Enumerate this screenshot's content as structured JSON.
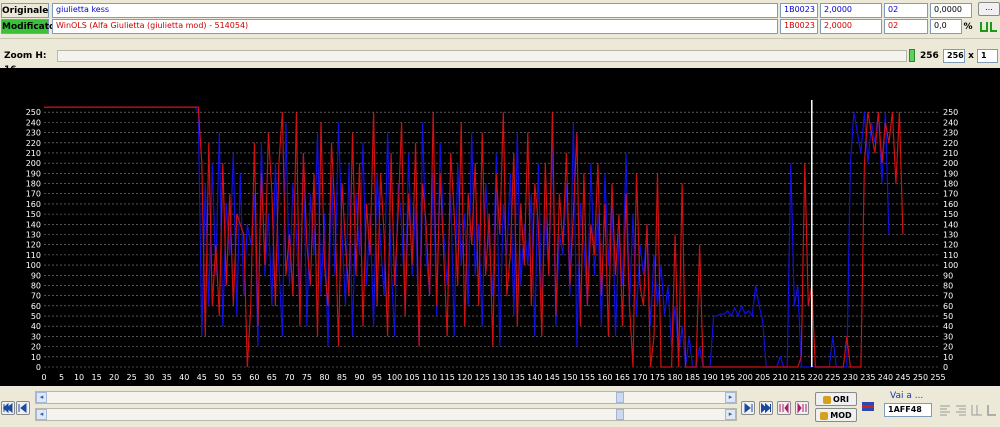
{
  "header": {
    "original_label": "Originale",
    "modified_label": "Modificato",
    "original": {
      "name": "giulietta kess",
      "address": "1B0023",
      "factor": "2,0000",
      "width": "02",
      "offset": "0,0000"
    },
    "modified": {
      "name": "WinOLS (Alfa Giulietta (giulietta mod) - 514054)",
      "address": "1B0023",
      "factor": "2,0000",
      "width": "02",
      "offset": "0,0"
    },
    "percent_symbol": "%",
    "ellipsis_button": "...",
    "close_glyph": "×"
  },
  "zoombar": {
    "label": "Zoom H: 16",
    "width_value": "256",
    "width_field": "256",
    "times_symbol": "x",
    "multiplier": "1"
  },
  "chart_data": {
    "type": "line",
    "ylim": [
      0,
      260
    ],
    "xlim": [
      0,
      255
    ],
    "y_ticks": [
      "0",
      "10",
      "20",
      "30",
      "40",
      "50",
      "60",
      "70",
      "80",
      "90",
      "100",
      "110",
      "120",
      "130",
      "140",
      "150",
      "160",
      "170",
      "180",
      "190",
      "200",
      "210",
      "220",
      "230",
      "240",
      "250"
    ],
    "x_ticks": [
      "0",
      "5",
      "10",
      "15",
      "20",
      "25",
      "30",
      "35",
      "40",
      "45",
      "50",
      "55",
      "60",
      "65",
      "70",
      "75",
      "80",
      "85",
      "90",
      "95",
      "100",
      "105",
      "110",
      "115",
      "120",
      "125",
      "130",
      "135",
      "140",
      "145",
      "150",
      "155",
      "160",
      "165",
      "170",
      "175",
      "180",
      "185",
      "190",
      "195",
      "200",
      "205",
      "210",
      "215",
      "220",
      "225",
      "230",
      "235",
      "240",
      "245",
      "250",
      "255"
    ],
    "cursor_x": 219,
    "grid": "horizontal-dashed",
    "colors": {
      "original": "#1010e0",
      "modified": "#d01010",
      "background": "#000000",
      "grid": "#8a8a8a",
      "cursor": "#ffffff"
    },
    "series": [
      {
        "color": "#1010e0",
        "values": [
          255,
          255,
          255,
          255,
          255,
          255,
          255,
          255,
          255,
          255,
          255,
          255,
          255,
          255,
          255,
          255,
          255,
          255,
          255,
          255,
          255,
          255,
          255,
          255,
          255,
          255,
          255,
          255,
          255,
          255,
          255,
          255,
          255,
          255,
          255,
          255,
          255,
          255,
          255,
          255,
          255,
          255,
          255,
          255,
          250,
          30,
          180,
          60,
          200,
          90,
          230,
          40,
          160,
          110,
          210,
          50,
          190,
          70,
          140,
          120,
          170,
          20,
          220,
          90,
          150,
          60,
          200,
          100,
          30,
          240,
          80,
          180,
          130,
          60,
          210,
          40,
          170,
          110,
          230,
          70,
          150,
          20,
          190,
          90,
          240,
          130,
          60,
          200,
          30,
          170,
          110,
          220,
          80,
          150,
          40,
          190,
          120,
          70,
          230,
          100,
          30,
          180,
          140,
          60,
          210,
          90,
          160,
          20,
          240,
          110,
          70,
          190,
          50,
          220,
          130,
          80,
          170,
          30,
          200,
          100,
          150,
          60,
          230,
          90,
          140,
          40,
          180,
          120,
          70,
          210,
          20,
          160,
          110,
          190,
          50,
          230,
          80,
          140,
          100,
          170,
          30,
          200,
          60,
          150,
          90,
          220,
          40,
          130,
          110,
          180,
          70,
          240,
          20,
          160,
          120,
          60,
          200,
          90,
          150,
          40,
          190,
          100,
          170,
          30,
          130,
          80,
          210,
          60,
          150,
          50,
          120,
          90,
          140,
          40,
          110,
          60,
          100,
          50,
          80,
          20,
          60,
          10,
          40,
          0,
          30,
          0,
          0,
          20,
          0,
          0,
          0,
          50,
          50,
          52,
          52,
          55,
          50,
          58,
          50,
          60,
          52,
          55,
          50,
          80,
          60,
          45,
          0,
          0,
          0,
          0,
          10,
          0,
          0,
          200,
          60,
          80,
          0,
          0,
          0,
          0,
          0,
          0,
          0,
          0,
          0,
          30,
          0,
          0,
          0,
          0,
          200,
          250,
          230,
          210,
          250,
          200,
          240,
          220,
          250,
          180,
          250,
          130
        ]
      },
      {
        "color": "#d01010",
        "values": [
          255,
          255,
          255,
          255,
          255,
          255,
          255,
          255,
          255,
          255,
          255,
          255,
          255,
          255,
          255,
          255,
          255,
          255,
          255,
          255,
          255,
          255,
          255,
          255,
          255,
          255,
          255,
          255,
          255,
          255,
          255,
          255,
          255,
          255,
          255,
          255,
          255,
          255,
          255,
          255,
          255,
          255,
          255,
          255,
          255,
          200,
          30,
          220,
          60,
          120,
          50,
          200,
          80,
          170,
          60,
          150,
          140,
          130,
          0,
          60,
          220,
          40,
          190,
          100,
          230,
          170,
          60,
          200,
          250,
          90,
          130,
          70,
          250,
          40,
          210,
          120,
          80,
          190,
          30,
          240,
          100,
          60,
          220,
          150,
          20,
          180,
          120,
          70,
          230,
          90,
          200,
          40,
          160,
          110,
          250,
          60,
          190,
          130,
          30,
          210,
          80,
          150,
          240,
          50,
          170,
          100,
          220,
          20,
          180,
          140,
          70,
          250,
          60,
          190,
          110,
          30,
          210,
          150,
          80,
          240,
          40,
          170,
          120,
          200,
          60,
          230,
          90,
          150,
          20,
          190,
          130,
          250,
          70,
          110,
          210,
          40,
          160,
          100,
          230,
          60,
          180,
          140,
          30,
          200,
          90,
          250,
          50,
          170,
          120,
          210,
          80,
          150,
          230,
          40,
          190,
          60,
          140,
          110,
          200,
          70,
          160,
          30,
          180,
          90,
          150,
          40,
          170,
          60,
          0,
          190,
          80,
          60,
          140,
          0,
          30,
          190,
          0,
          0,
          0,
          0,
          130,
          0,
          180,
          0,
          0,
          0,
          0,
          120,
          0,
          0,
          0,
          0,
          0,
          0,
          0,
          0,
          0,
          0,
          0,
          0,
          0,
          0,
          0,
          0,
          0,
          0,
          0,
          0,
          0,
          0,
          0,
          0,
          0,
          0,
          0,
          0,
          10,
          200,
          60,
          80,
          0,
          0,
          0,
          0,
          0,
          0,
          0,
          0,
          0,
          30,
          0,
          0,
          0,
          0,
          200,
          250,
          230,
          210,
          250,
          200,
          240,
          220,
          250,
          180,
          250,
          130
        ]
      }
    ]
  },
  "footer": {
    "ori_button": "ORI",
    "mod_button": "MOD",
    "goto_label": "Vai a ...",
    "goto_value": "1AFF48"
  }
}
